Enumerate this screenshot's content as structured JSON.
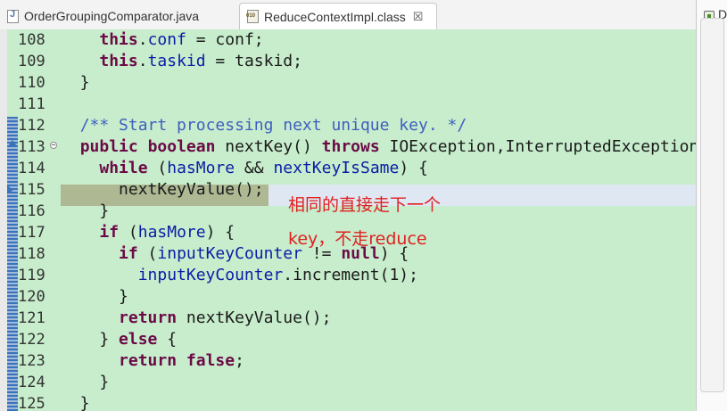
{
  "tabs": [
    {
      "label": "OrderGroupingComparator.java",
      "icon": "java-file-icon",
      "active": false
    },
    {
      "label": "ReduceContextImpl.class",
      "icon": "class-file-icon",
      "active": true,
      "close": "☒"
    }
  ],
  "right_panel": {
    "label": "D"
  },
  "code_lines": [
    {
      "num": "108",
      "parts": [
        {
          "t": "    "
        },
        {
          "t": "this",
          "c": "kw"
        },
        {
          "t": "."
        },
        {
          "t": "conf",
          "c": "fld"
        },
        {
          "t": " = conf;"
        }
      ]
    },
    {
      "num": "109",
      "parts": [
        {
          "t": "    "
        },
        {
          "t": "this",
          "c": "kw"
        },
        {
          "t": "."
        },
        {
          "t": "taskid",
          "c": "fld"
        },
        {
          "t": " = taskid;"
        }
      ]
    },
    {
      "num": "110",
      "parts": [
        {
          "t": "  }"
        }
      ]
    },
    {
      "num": "111",
      "parts": [
        {
          "t": ""
        }
      ]
    },
    {
      "num": "112",
      "parts": [
        {
          "t": "  "
        },
        {
          "t": "/** Start processing next unique key. */",
          "c": "cmt"
        }
      ]
    },
    {
      "num": "113",
      "marker": "override",
      "fold": true,
      "parts": [
        {
          "t": "  "
        },
        {
          "t": "public",
          "c": "kw"
        },
        {
          "t": " "
        },
        {
          "t": "boolean",
          "c": "kw"
        },
        {
          "t": " nextKey() "
        },
        {
          "t": "throws",
          "c": "kw"
        },
        {
          "t": " IOException,InterruptedException {"
        }
      ]
    },
    {
      "num": "114",
      "parts": [
        {
          "t": "    "
        },
        {
          "t": "while",
          "c": "kw"
        },
        {
          "t": " ("
        },
        {
          "t": "hasMore",
          "c": "fld"
        },
        {
          "t": " && "
        },
        {
          "t": "nextKeyIsSame",
          "c": "fld"
        },
        {
          "t": ") {"
        }
      ]
    },
    {
      "num": "115",
      "marker": "current",
      "parts": [
        {
          "t": "      nextKeyValue();"
        }
      ]
    },
    {
      "num": "116",
      "parts": [
        {
          "t": "    }"
        }
      ]
    },
    {
      "num": "117",
      "parts": [
        {
          "t": "    "
        },
        {
          "t": "if",
          "c": "kw"
        },
        {
          "t": " ("
        },
        {
          "t": "hasMore",
          "c": "fld"
        },
        {
          "t": ") {"
        }
      ]
    },
    {
      "num": "118",
      "parts": [
        {
          "t": "      "
        },
        {
          "t": "if",
          "c": "kw"
        },
        {
          "t": " ("
        },
        {
          "t": "inputKeyCounter",
          "c": "fld"
        },
        {
          "t": " != "
        },
        {
          "t": "null",
          "c": "kw"
        },
        {
          "t": ") {"
        }
      ]
    },
    {
      "num": "119",
      "parts": [
        {
          "t": "        "
        },
        {
          "t": "inputKeyCounter",
          "c": "fld"
        },
        {
          "t": ".increment(1);"
        }
      ]
    },
    {
      "num": "120",
      "parts": [
        {
          "t": "      }"
        }
      ]
    },
    {
      "num": "121",
      "parts": [
        {
          "t": "      "
        },
        {
          "t": "return",
          "c": "kw"
        },
        {
          "t": " nextKeyValue();"
        }
      ]
    },
    {
      "num": "122",
      "parts": [
        {
          "t": "    } "
        },
        {
          "t": "else",
          "c": "kw"
        },
        {
          "t": " {"
        }
      ]
    },
    {
      "num": "123",
      "parts": [
        {
          "t": "      "
        },
        {
          "t": "return",
          "c": "kw"
        },
        {
          "t": " "
        },
        {
          "t": "false",
          "c": "kw"
        },
        {
          "t": ";"
        }
      ]
    },
    {
      "num": "124",
      "parts": [
        {
          "t": "    }"
        }
      ]
    },
    {
      "num": "125",
      "parts": [
        {
          "t": "  }"
        }
      ]
    }
  ],
  "annotations": {
    "line1": "相同的直接走下一个",
    "line2": "key，不走reduce"
  },
  "colors": {
    "editor_bg": "#c7edcc",
    "keyword": "#6c0a47",
    "field": "#0b1ca6",
    "comment": "#3f5fbf",
    "annotation": "#e02020"
  }
}
